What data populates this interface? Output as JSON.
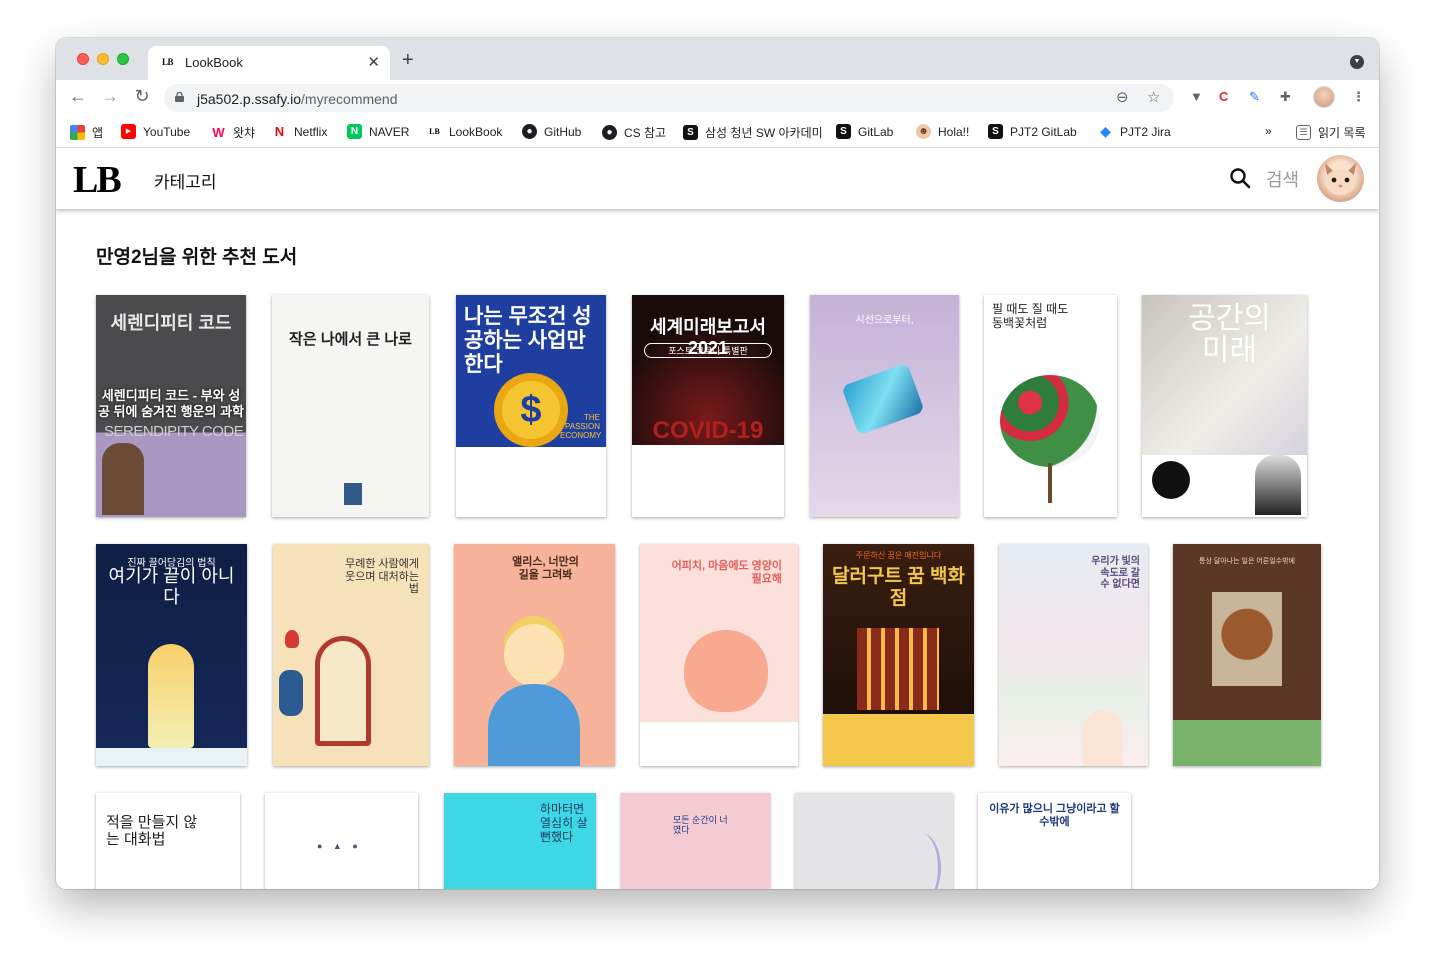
{
  "browser": {
    "tab_title": "LookBook",
    "tab_favicon": "LB",
    "url_host": "j5a502.p.ssafy.io",
    "url_path": "/myrecommend",
    "bookmarks": [
      {
        "label": "앱",
        "icon": "apps-grid-icon"
      },
      {
        "label": "YouTube",
        "icon": "youtube-icon"
      },
      {
        "label": "왓챠",
        "icon": "watcha-icon"
      },
      {
        "label": "Netflix",
        "icon": "netflix-icon"
      },
      {
        "label": "NAVER",
        "icon": "naver-icon"
      },
      {
        "label": "LookBook",
        "icon": "lookbook-icon"
      },
      {
        "label": "GitHub",
        "icon": "github-icon"
      },
      {
        "label": "CS 참고",
        "icon": "github-icon"
      },
      {
        "label": "삼성 청년 SW 아카데미",
        "icon": "ssafy-icon"
      },
      {
        "label": "GitLab",
        "icon": "ssafy-icon"
      },
      {
        "label": "Hola!!",
        "icon": "hola-icon"
      },
      {
        "label": "PJT2 GitLab",
        "icon": "ssafy-icon"
      },
      {
        "label": "PJT2 Jira",
        "icon": "jira-icon"
      }
    ],
    "more_bookmarks": "»",
    "reading_list": "읽기 목록"
  },
  "header": {
    "logo": "LB",
    "category": "카테고리",
    "search_label": "검색"
  },
  "main": {
    "heading": "만영2님을 위한 추천 도서",
    "books": [
      {
        "cover_title": "세렌디피티 코드",
        "hover_title": "세렌디피티 코드 - 부와 성공 뒤에 숨겨진 행운의 과학",
        "footer": "SERENDIPITY CODE",
        "bg": "#5a5a5c",
        "fg": "#e9e9e9"
      },
      {
        "cover_title": "작은 나에서 큰 나로",
        "bg": "#f5f5f3",
        "fg": "#222"
      },
      {
        "cover_title": "나는 무조건 성공하는 사업만 한다",
        "footer": "THE PASSION ECONOMY",
        "bg": "#1f3fa0",
        "fg": "#ffffff"
      },
      {
        "cover_title": "세계미래보고서 2021",
        "sub": "포스트 코로나 특별판",
        "footer": "COVID-19",
        "bg": "#1a0b0b",
        "fg": "#ffffff"
      },
      {
        "cover_title": "시선으로부터,",
        "bg": "#c9b6d8",
        "fg": "#ffffff"
      },
      {
        "cover_title": "필 때도 질 때도 동백꽃처럼",
        "bg": "#ffffff",
        "fg": "#222"
      },
      {
        "cover_title": "공간의 미래",
        "bg": "#d8d6d2",
        "fg": "#ffffff"
      },
      {
        "cover_title": "여기가 끝이 아니다",
        "sub": "진짜 끌어당김의 법칙",
        "bg": "#0e1e44",
        "fg": "#ffffff"
      },
      {
        "cover_title": "무례한 사람에게 웃으며 대처하는 법",
        "bg": "#f6e1b8",
        "fg": "#333"
      },
      {
        "cover_title": "앨리스, 너만의 길을 그려봐",
        "bg": "#f6b39a",
        "fg": "#4a2a1a"
      },
      {
        "cover_title": "어피치, 마음에도 영양이 필요해",
        "bg": "#fbe0dc",
        "fg": "#e2615a"
      },
      {
        "cover_title": "달러구트 꿈 백화점",
        "sub": "주문하신 꿈은 매진입니다",
        "bg": "#2a160d",
        "fg": "#f3c84a"
      },
      {
        "cover_title": "우리가 빛의 속도로 갈 수 없다면",
        "bg": "#e9eef4",
        "fg": "#5b4a7a"
      },
      {
        "cover_title": "통상 달아나는 일은 어른일수밖에",
        "bg": "#5b3826",
        "fg": "#e9d8c4"
      },
      {
        "cover_title": "적을 만들지 않는 대화법",
        "bg": "#ffffff",
        "fg": "#222"
      },
      {
        "cover_title": "",
        "bg": "#ffffff",
        "fg": "#222"
      },
      {
        "cover_title": "하마터면 열심히 살 뻔했다",
        "bg": "#3ed7e6",
        "fg": "#1b3a5a"
      },
      {
        "cover_title": "모든 순간이 너였다",
        "bg": "#f5cbd3",
        "fg": "#1b3a7a"
      },
      {
        "cover_title": "",
        "bg": "#e4e4e6",
        "fg": "#6a6aa0"
      },
      {
        "cover_title": "이유가 많으니 그냥이라고 할 수밖에",
        "bg": "#ffffff",
        "fg": "#1b3a7a"
      }
    ]
  }
}
